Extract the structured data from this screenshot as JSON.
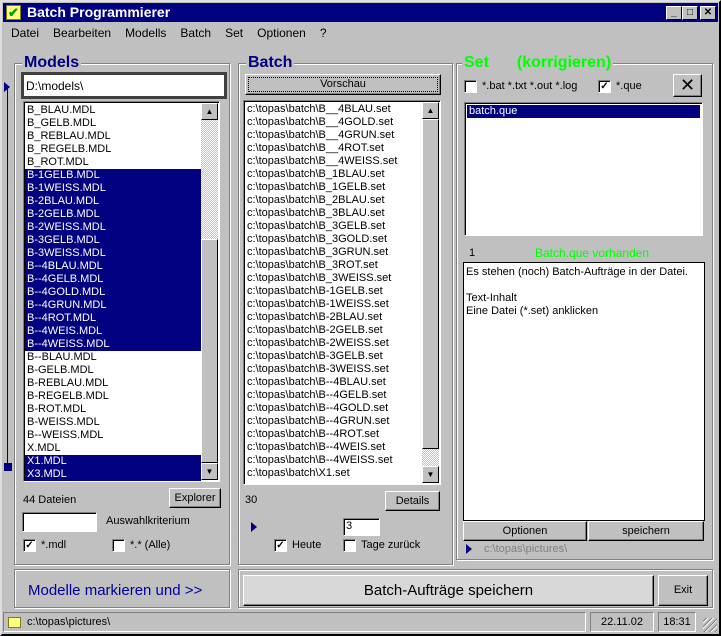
{
  "window": {
    "title": "Batch Programmierer"
  },
  "menu": [
    "Datei",
    "Bearbeiten",
    "Modells",
    "Batch",
    "Set",
    "Optionen",
    "?"
  ],
  "models": {
    "title": "Models",
    "path": "D:\\models\\",
    "items": [
      {
        "label": "B_BLAU.MDL",
        "selected": false
      },
      {
        "label": "B_GELB.MDL",
        "selected": false
      },
      {
        "label": "B_REBLAU.MDL",
        "selected": false
      },
      {
        "label": "B_REGELB.MDL",
        "selected": false
      },
      {
        "label": "B_ROT.MDL",
        "selected": false
      },
      {
        "label": "B-1GELB.MDL",
        "selected": true
      },
      {
        "label": "B-1WEISS.MDL",
        "selected": true
      },
      {
        "label": "B-2BLAU.MDL",
        "selected": true
      },
      {
        "label": "B-2GELB.MDL",
        "selected": true
      },
      {
        "label": "B-2WEISS.MDL",
        "selected": true
      },
      {
        "label": "B-3GELB.MDL",
        "selected": true
      },
      {
        "label": "B-3WEISS.MDL",
        "selected": true
      },
      {
        "label": "B--4BLAU.MDL",
        "selected": true
      },
      {
        "label": "B--4GELB.MDL",
        "selected": true
      },
      {
        "label": "B--4GOLD.MDL",
        "selected": true
      },
      {
        "label": "B--4GRUN.MDL",
        "selected": true
      },
      {
        "label": "B--4ROT.MDL",
        "selected": true
      },
      {
        "label": "B--4WEIS.MDL",
        "selected": true
      },
      {
        "label": "B--4WEISS.MDL",
        "selected": true
      },
      {
        "label": "B--BLAU.MDL",
        "selected": false
      },
      {
        "label": "B-GELB.MDL",
        "selected": false
      },
      {
        "label": "B-REBLAU.MDL",
        "selected": false
      },
      {
        "label": "B-REGELB.MDL",
        "selected": false
      },
      {
        "label": "B-ROT.MDL",
        "selected": false
      },
      {
        "label": "B-WEISS.MDL",
        "selected": false
      },
      {
        "label": "B--WEISS.MDL",
        "selected": false
      },
      {
        "label": "X.MDL",
        "selected": false
      },
      {
        "label": "X1.MDL",
        "selected": true
      },
      {
        "label": "X3.MDL",
        "selected": true
      }
    ],
    "count": "44 Dateien",
    "explorer": "Explorer",
    "criteria_value": "",
    "criteria_label": "Auswahlkriterium",
    "cb_mdl": {
      "label": "*.mdl",
      "checked": true
    },
    "cb_all": {
      "label": "*.* (Alle)",
      "checked": false
    },
    "mark_button": "Modelle markieren und >>"
  },
  "batch": {
    "title": "Batch",
    "preview": "Vorschau",
    "items": [
      "c:\\topas\\batch\\B__4BLAU.set",
      "c:\\topas\\batch\\B__4GOLD.set",
      "c:\\topas\\batch\\B__4GRUN.set",
      "c:\\topas\\batch\\B__4ROT.set",
      "c:\\topas\\batch\\B__4WEISS.set",
      "c:\\topas\\batch\\B_1BLAU.set",
      "c:\\topas\\batch\\B_1GELB.set",
      "c:\\topas\\batch\\B_2BLAU.set",
      "c:\\topas\\batch\\B_3BLAU.set",
      "c:\\topas\\batch\\B_3GELB.set",
      "c:\\topas\\batch\\B_3GOLD.set",
      "c:\\topas\\batch\\B_3GRUN.set",
      "c:\\topas\\batch\\B_3ROT.set",
      "c:\\topas\\batch\\B_3WEISS.set",
      "c:\\topas\\batch\\B-1GELB.set",
      "c:\\topas\\batch\\B-1WEISS.set",
      "c:\\topas\\batch\\B-2BLAU.set",
      "c:\\topas\\batch\\B-2GELB.set",
      "c:\\topas\\batch\\B-2WEISS.set",
      "c:\\topas\\batch\\B-3GELB.set",
      "c:\\topas\\batch\\B-3WEISS.set",
      "c:\\topas\\batch\\B--4BLAU.set",
      "c:\\topas\\batch\\B--4GELB.set",
      "c:\\topas\\batch\\B--4GOLD.set",
      "c:\\topas\\batch\\B--4GRUN.set",
      "c:\\topas\\batch\\B--4ROT.set",
      "c:\\topas\\batch\\B--4WEIS.set",
      "c:\\topas\\batch\\B--4WEISS.set",
      "c:\\topas\\batch\\X1.set"
    ],
    "count": "30",
    "details": "Details",
    "days_value": "3",
    "cb_today": {
      "label": "Heute",
      "checked": true
    },
    "cb_days": {
      "label": "Tage zurück",
      "checked": false
    },
    "save_button": "Batch-Aufträge speichern"
  },
  "set": {
    "title": "Set",
    "subtitle": "(korrigieren)",
    "title_color": "#00ff00",
    "cb_bat": {
      "label": "*.bat *.txt *.out *.log",
      "checked": false
    },
    "cb_que": {
      "label": "*.que",
      "checked": true
    },
    "close": "✕",
    "items": [
      {
        "label": "batch.que",
        "selected": true
      }
    ],
    "count": "1",
    "status": "Batch.que vorhanden",
    "text": "Es stehen (noch) Batch-Aufträge in der Datei.\n\nText-Inhalt\nEine Datei (*.set) anklicken",
    "options": "Optionen",
    "save": "speichern",
    "path": "c:\\topas\\pictures\\"
  },
  "exit": "Exit",
  "statusbar": {
    "path": "c:\\topas\\pictures\\",
    "date": "22.11.02",
    "time": "18:31"
  }
}
